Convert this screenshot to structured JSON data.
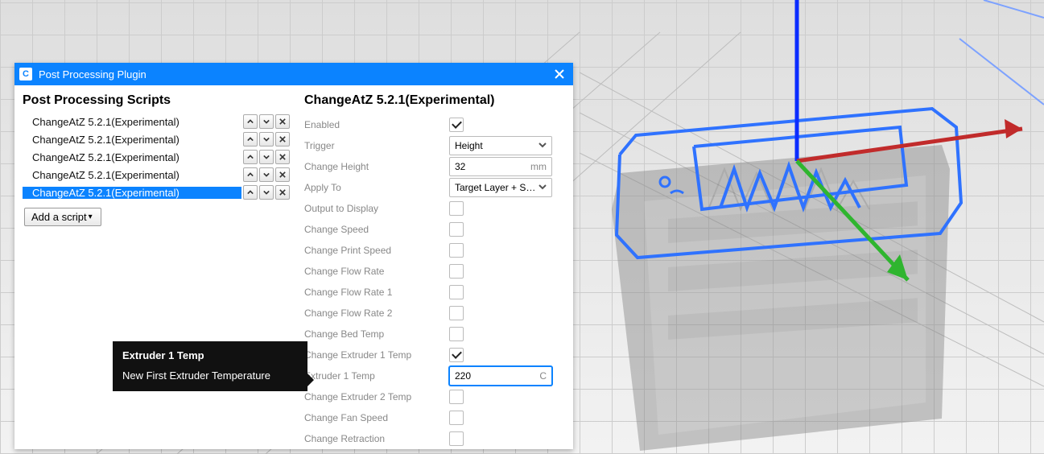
{
  "dialog": {
    "title": "Post Processing Plugin"
  },
  "left": {
    "section_title": "Post Processing Scripts",
    "scripts": [
      {
        "name": "ChangeAtZ 5.2.1(Experimental)",
        "selected": false
      },
      {
        "name": "ChangeAtZ 5.2.1(Experimental)",
        "selected": false
      },
      {
        "name": "ChangeAtZ 5.2.1(Experimental)",
        "selected": false
      },
      {
        "name": "ChangeAtZ 5.2.1(Experimental)",
        "selected": false
      },
      {
        "name": "ChangeAtZ 5.2.1(Experimental)",
        "selected": true
      }
    ],
    "add_script": "Add a script"
  },
  "right": {
    "panel_title": "ChangeAtZ 5.2.1(Experimental)",
    "settings": {
      "enabled": {
        "label": "Enabled",
        "type": "check",
        "checked": true
      },
      "trigger": {
        "label": "Trigger",
        "type": "select",
        "value": "Height"
      },
      "change_height": {
        "label": "Change Height",
        "type": "num",
        "value": "32",
        "unit": "mm"
      },
      "apply_to": {
        "label": "Apply To",
        "type": "select",
        "value": "Target Layer + Su…"
      },
      "output_display": {
        "label": "Output to Display",
        "type": "check",
        "checked": false
      },
      "change_speed": {
        "label": "Change Speed",
        "type": "check",
        "checked": false
      },
      "change_print_speed": {
        "label": "Change Print Speed",
        "type": "check",
        "checked": false
      },
      "change_flow": {
        "label": "Change Flow Rate",
        "type": "check",
        "checked": false
      },
      "change_flow1": {
        "label": "Change Flow Rate 1",
        "type": "check",
        "checked": false
      },
      "change_flow2": {
        "label": "Change Flow Rate 2",
        "type": "check",
        "checked": false
      },
      "change_bed": {
        "label": "Change Bed Temp",
        "type": "check",
        "checked": false
      },
      "change_e1_temp": {
        "label": "Change Extruder 1 Temp",
        "type": "check",
        "checked": true
      },
      "e1_temp": {
        "label": "Extruder 1 Temp",
        "type": "num",
        "value": "220",
        "unit": "C",
        "focused": true
      },
      "change_e2_temp": {
        "label": "Change Extruder 2 Temp",
        "type": "check",
        "checked": false
      },
      "change_fan": {
        "label": "Change Fan Speed",
        "type": "check",
        "checked": false
      },
      "change_retract": {
        "label": "Change Retraction",
        "type": "check",
        "checked": false
      }
    }
  },
  "tooltip": {
    "title": "Extruder 1 Temp",
    "text": "New First Extruder Temperature"
  },
  "viewport": {
    "axis_colors": {
      "x": "#c12b2b",
      "y": "#2fb52f",
      "z": "#0b2cff"
    },
    "outline_color": "#2f72ff"
  }
}
